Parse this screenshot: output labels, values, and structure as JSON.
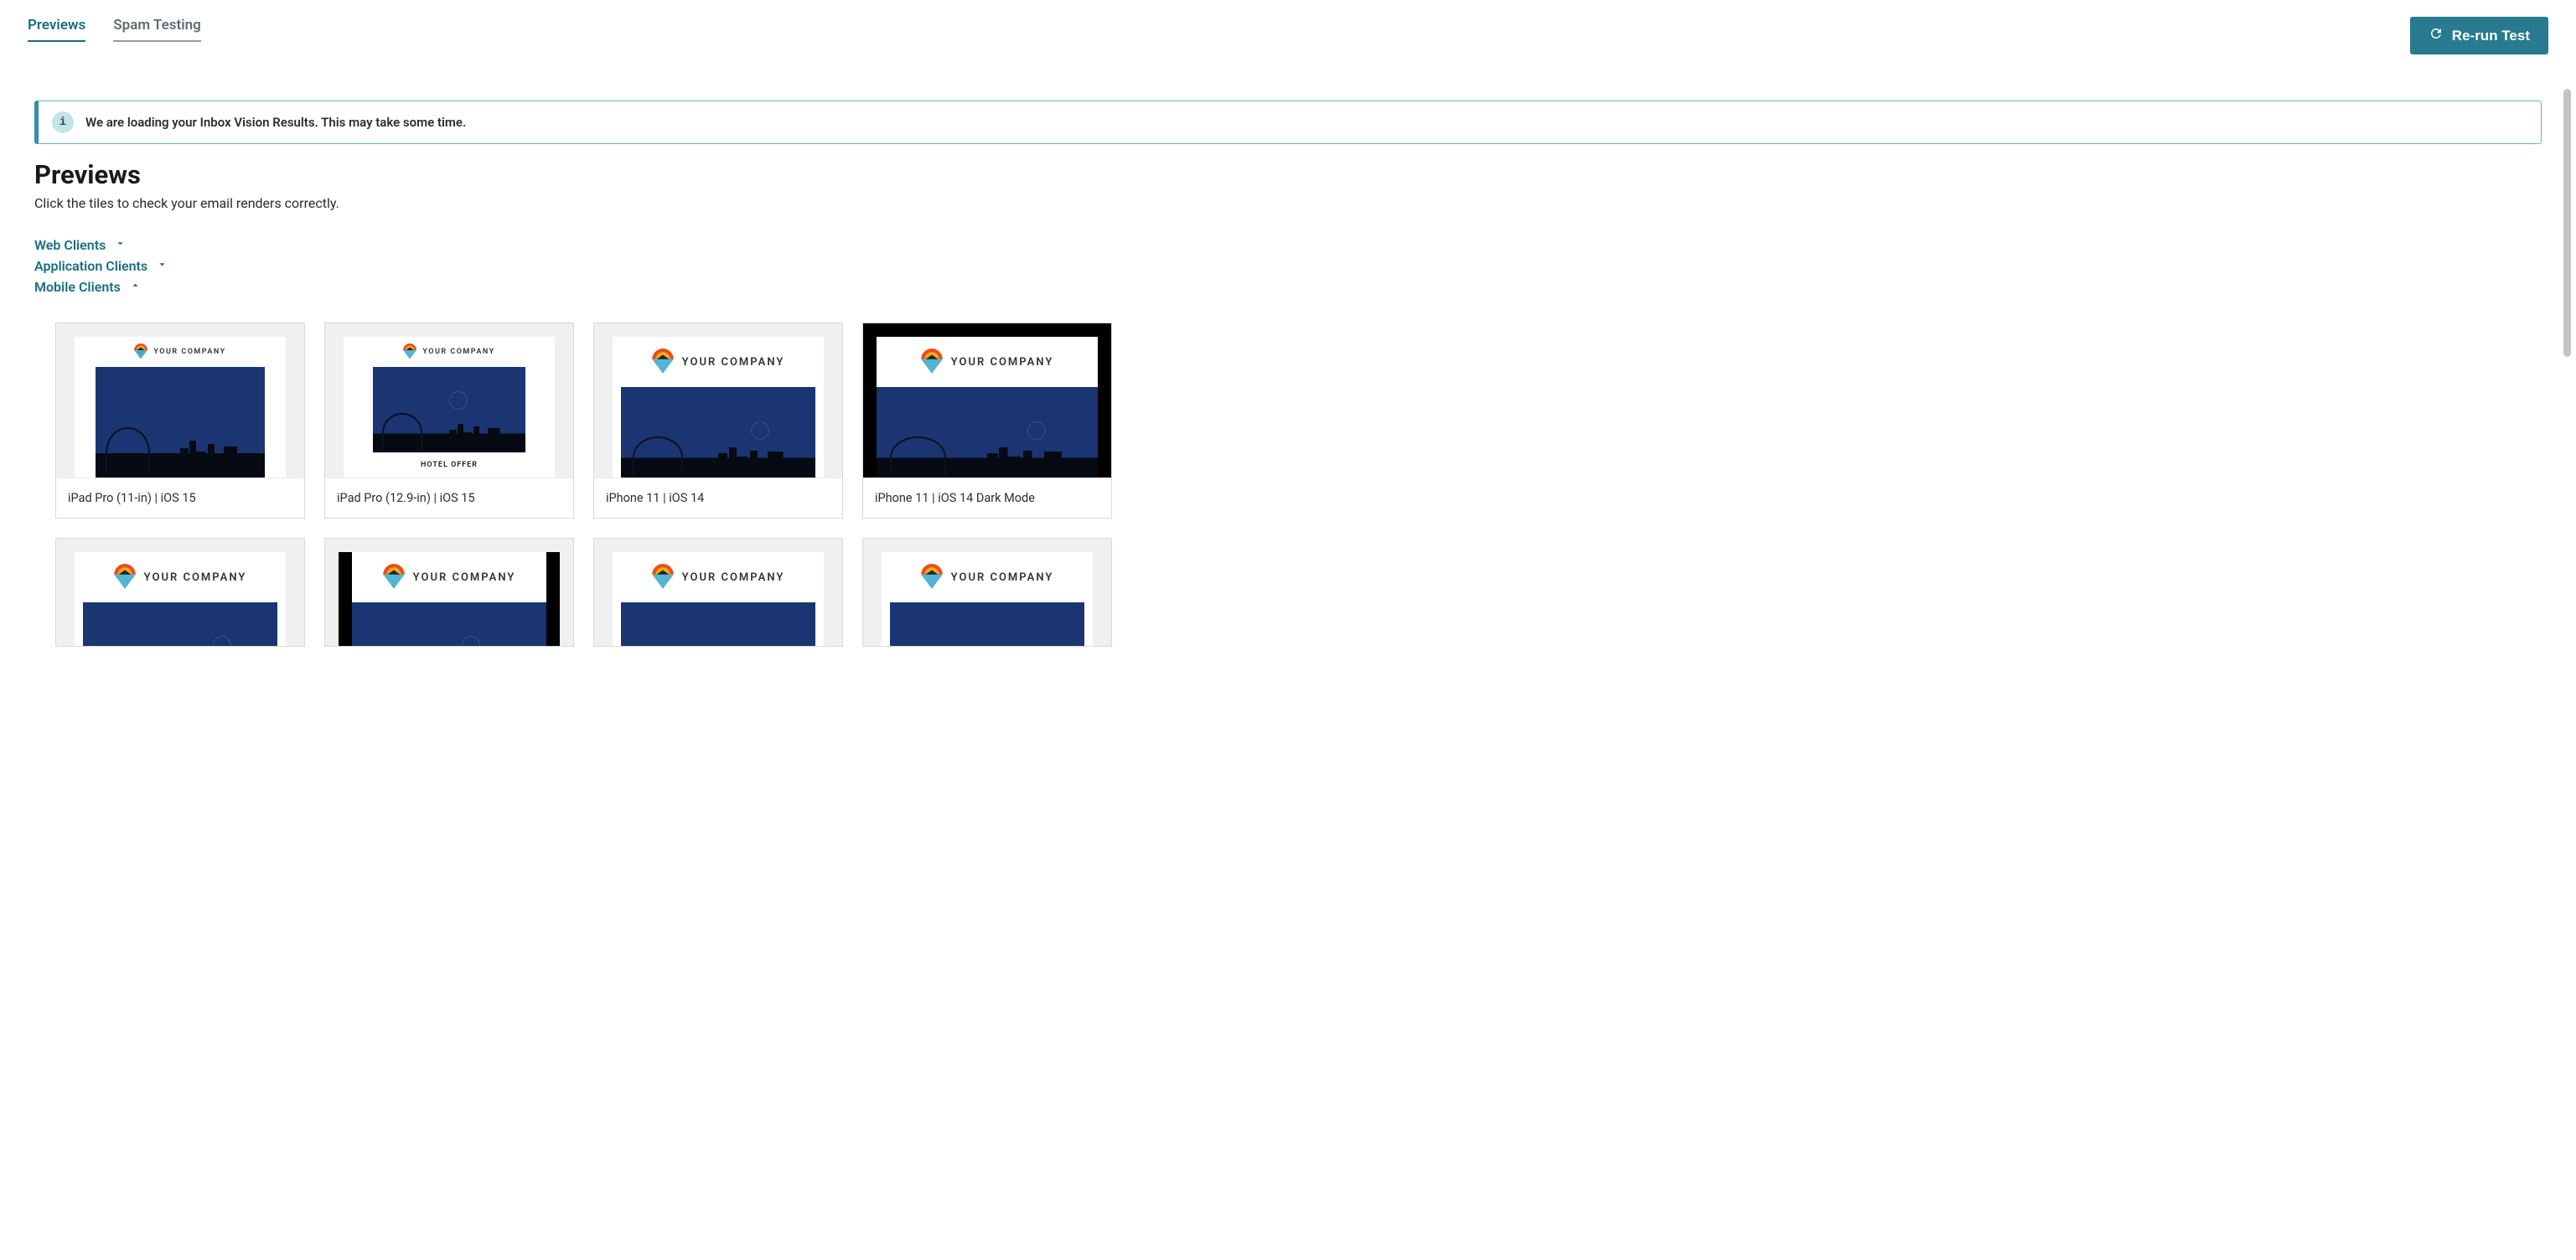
{
  "tabs": {
    "previews": "Previews",
    "spam_testing": "Spam Testing"
  },
  "actions": {
    "rerun": "Re-run Test"
  },
  "alert": {
    "text": "We are loading your Inbox Vision Results. This may take some time."
  },
  "page": {
    "title": "Previews",
    "subtitle": "Click the tiles to check your email renders correctly."
  },
  "groups": {
    "web": "Web Clients",
    "app": "Application Clients",
    "mobile": "Mobile Clients"
  },
  "thumb": {
    "company_label": "YOUR  COMPANY",
    "offer_label": "HOTEL OFFER"
  },
  "tiles": [
    {
      "label": "iPad Pro (11-in) | iOS 15"
    },
    {
      "label": "iPad Pro (12.9-in) | iOS 15"
    },
    {
      "label": "iPhone 11 | iOS 14"
    },
    {
      "label": "iPhone 11 | iOS 14 Dark Mode"
    }
  ]
}
